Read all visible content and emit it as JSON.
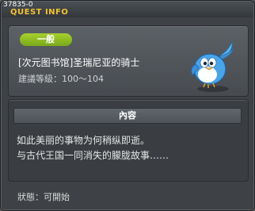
{
  "window": {
    "id": "37835-0",
    "title": "QUEST INFO",
    "close_glyph": "×"
  },
  "quest": {
    "category": "一般",
    "name": "[次元图书馆]圣瑞尼亚的骑士",
    "level_requirement": "建議等級：100～104",
    "icon": "blue-bird-icon"
  },
  "content": {
    "header": "內容",
    "lines": [
      "如此美丽的事物为何稍纵即逝。",
      "与古代王国一同消失的朦胧故事……"
    ]
  },
  "status": "狀態：可開始",
  "colors": {
    "title": "#f2c230",
    "badge": "#8fbf22",
    "panel": "#3e4246"
  }
}
